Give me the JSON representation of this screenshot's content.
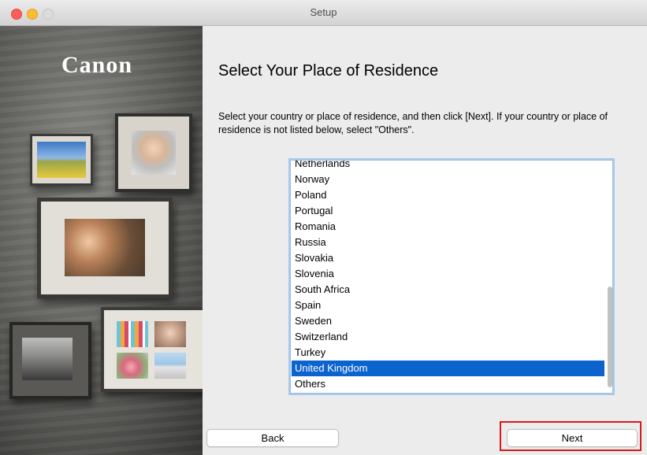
{
  "window": {
    "title": "Setup"
  },
  "brand": {
    "logo_text": "Canon"
  },
  "main": {
    "heading": "Select Your Place of Residence",
    "description": "Select your country or place of residence, and then click [Next]. If your country or place of residence is not listed below, select \"Others\"."
  },
  "countries": {
    "items": [
      "Netherlands",
      "Norway",
      "Poland",
      "Portugal",
      "Romania",
      "Russia",
      "Slovakia",
      "Slovenia",
      "South Africa",
      "Spain",
      "Sweden",
      "Switzerland",
      "Turkey",
      "United Kingdom",
      "Others"
    ],
    "selected": "United Kingdom"
  },
  "buttons": {
    "back": "Back",
    "next": "Next"
  },
  "colors": {
    "selection": "#0b63ce",
    "highlight_box": "#d7191c"
  }
}
